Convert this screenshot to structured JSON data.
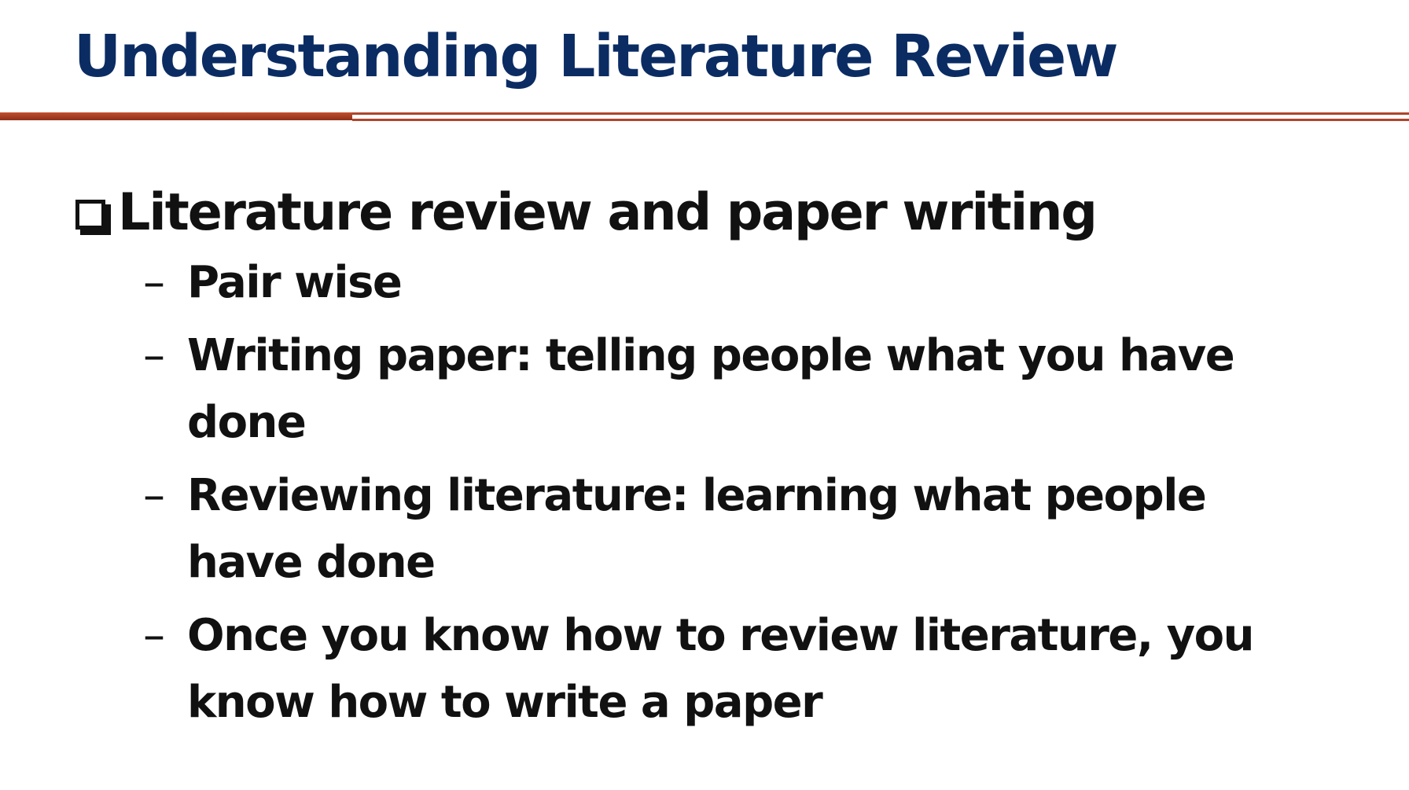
{
  "slide": {
    "title": "Understanding Literature Review",
    "accent_color": "#0b2c63",
    "rule_color": "#b0452b",
    "main_bullet": {
      "icon": "checkbox-bullet-icon",
      "text": "Literature review and paper writing"
    },
    "sub_bullets": [
      {
        "dash": "–",
        "text": "Pair wise"
      },
      {
        "dash": "–",
        "text": "Writing paper: telling people what you have done"
      },
      {
        "dash": "–",
        "text": "Reviewing literature: learning what people have done"
      },
      {
        "dash": "–",
        "text": "Once you know how to review literature, you know how to write a paper"
      }
    ]
  }
}
